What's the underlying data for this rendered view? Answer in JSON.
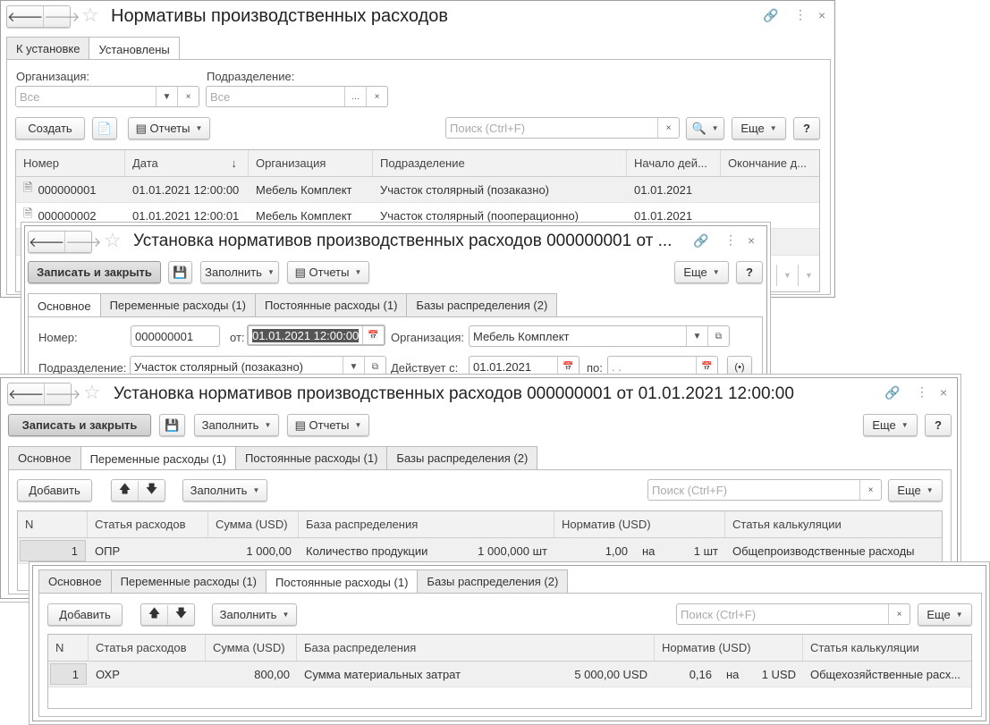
{
  "w1": {
    "title": "Нормативы производственных расходов",
    "tabs": [
      "К установке",
      "Установлены"
    ],
    "org_label": "Организация:",
    "dep_label": "Подразделение:",
    "org_ph": "Все",
    "dep_ph": "Все",
    "create": "Создать",
    "reports": "Отчеты",
    "search_ph": "Поиск (Ctrl+F)",
    "more": "Еще",
    "help": "?",
    "columns": [
      "Номер",
      "Дата",
      "Организация",
      "Подразделение",
      "Начало дей...",
      "Окончание д..."
    ],
    "sort_arrow": "↓",
    "rows": [
      [
        "000000001",
        "01.01.2021 12:00:00",
        "Мебель Комплект",
        "Участок столярный (позаказно)",
        "01.01.2021",
        ""
      ],
      [
        "000000002",
        "01.01.2021 12:00:01",
        "Мебель Комплект",
        "Участок столярный (пооперационно)",
        "01.01.2021",
        ""
      ]
    ]
  },
  "w2": {
    "title": "Установка нормативов производственных расходов 000000001 от ...",
    "save_close": "Записать и закрыть",
    "fill": "Заполнить",
    "reports": "Отчеты",
    "more": "Еще",
    "help": "?",
    "tabs": [
      "Основное",
      "Переменные расходы (1)",
      "Постоянные расходы (1)",
      "Базы распределения (2)"
    ],
    "number_label": "Номер:",
    "number": "000000001",
    "from_label": "от:",
    "date": "01.01.2021 12:00:00",
    "org_label": "Организация:",
    "org": "Мебель Комплект",
    "dep_label": "Подразделение:",
    "dep": "Участок столярный (позаказно)",
    "valid_label": "Действует с:",
    "valid_from": "01.01.2021",
    "to_label": "по:",
    "valid_to": " .  ."
  },
  "w3": {
    "title": "Установка нормативов производственных расходов 000000001 от 01.01.2021 12:00:00",
    "save_close": "Записать и закрыть",
    "fill": "Заполнить",
    "reports": "Отчеты",
    "more": "Еще",
    "help": "?",
    "tabs": [
      "Основное",
      "Переменные расходы (1)",
      "Постоянные расходы (1)",
      "Базы распределения (2)"
    ],
    "add": "Добавить",
    "fill2": "Заполнить",
    "search_ph": "Поиск (Ctrl+F)",
    "more2": "Еще",
    "columns": [
      "N",
      "Статья расходов",
      "Сумма (USD)",
      "База распределения",
      "Норматив (USD)",
      "Статья калькуляции"
    ],
    "row": {
      "n": "1",
      "item": "ОПР",
      "sum": "1 000,00",
      "base": "Количество продукции",
      "base_qty": "1 000,000 шт",
      "norm": "1,00",
      "per": "на",
      "per_qty": "1 шт",
      "calc": "Общепроизводственные расходы"
    }
  },
  "w4": {
    "tabs": [
      "Основное",
      "Переменные расходы (1)",
      "Постоянные расходы (1)",
      "Базы распределения (2)"
    ],
    "add": "Добавить",
    "fill": "Заполнить",
    "search_ph": "Поиск (Ctrl+F)",
    "more": "Еще",
    "columns": [
      "N",
      "Статья расходов",
      "Сумма (USD)",
      "База распределения",
      "Норматив (USD)",
      "Статья калькуляции"
    ],
    "row": {
      "n": "1",
      "item": "ОХР",
      "sum": "800,00",
      "base": "Сумма материальных затрат",
      "base_qty": "5 000,00 USD",
      "norm": "0,16",
      "per": "на",
      "per_qty": "1 USD",
      "calc": "Общехозяйственные расх..."
    }
  }
}
